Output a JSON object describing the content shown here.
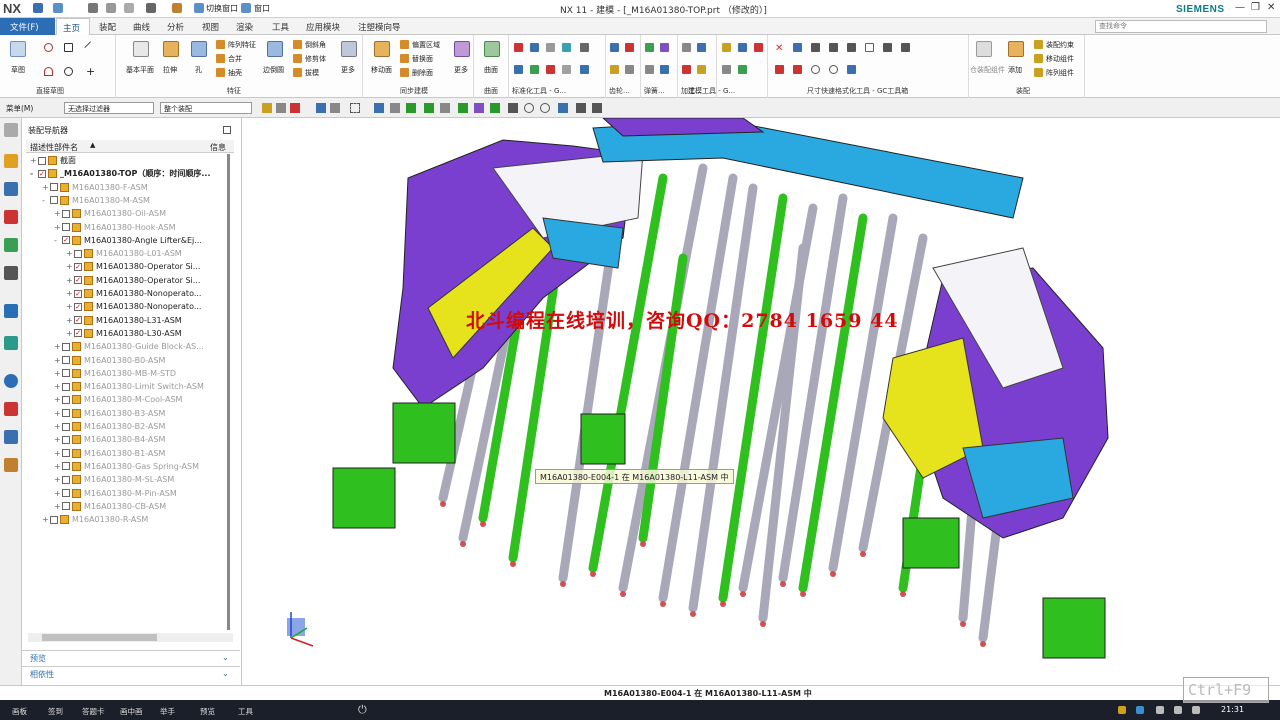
{
  "titlebar": {
    "logo": "NX",
    "title": "NX 11 - 建模 - [_M16A01380-TOP.prt （修改的）]",
    "brand": "SIEMENS",
    "switch_window": "切换窗口",
    "window_menu": "窗口"
  },
  "tabs": {
    "file": "文件(F)",
    "items": [
      "主页",
      "装配",
      "曲线",
      "分析",
      "视图",
      "渲染",
      "工具",
      "应用模块",
      "注塑模向导"
    ],
    "search_placeholder": "查找命令"
  },
  "ribbon": {
    "direct_sketch": {
      "sketch": "草图",
      "group": "直接草图"
    },
    "feature": {
      "datum_plane": "基本平面",
      "extrude": "拉伸",
      "hole": "孔",
      "pattern": "阵列特征",
      "unite": "合并",
      "shell": "抽壳",
      "edge_blend": "边倒圆",
      "chamfer": "倒斜角",
      "trim_body": "修剪体",
      "draft": "拔模",
      "more": "更多",
      "group": "特征"
    },
    "sync": {
      "move_face": "移动面",
      "offset_region": "偏置区域",
      "replace_face": "替换面",
      "delete_face": "删除面",
      "more": "更多",
      "group": "同步建模"
    },
    "surface": {
      "surface": "曲面",
      "group": "曲面"
    },
    "groups_small": [
      "标准化工具 - G...",
      "齿轮...",
      "弹簧...",
      "加工...",
      "建模工具 - G...",
      "尺寸快速格式化工具 - GC工具箱"
    ],
    "assembly": {
      "component": "仓装配组件",
      "add": "添加",
      "constraint": "装配约束",
      "move_component": "移动组件",
      "pattern_component": "阵列组件",
      "group": "装配"
    }
  },
  "toolbar2": {
    "menu": "菜单(M)",
    "filter": "无选择过滤器",
    "scope": "整个装配"
  },
  "navigator": {
    "title": "装配导航器",
    "col_name": "描述性部件名",
    "col_info": "信息",
    "rows": [
      {
        "label": "截面",
        "indent": 0,
        "exp": "+",
        "checked": false,
        "gray": false
      },
      {
        "label": "_M16A01380-TOP（顺序：时间顺序...",
        "indent": 0,
        "exp": "-",
        "checked": true,
        "gray": false,
        "bold": true
      },
      {
        "label": "M16A01380-F-ASM",
        "indent": 1,
        "exp": "+",
        "checked": false,
        "gray": true
      },
      {
        "label": "M16A01380-M-ASM",
        "indent": 1,
        "exp": "-",
        "checked": false,
        "gray": true
      },
      {
        "label": "M16A01380-Oil-ASM",
        "indent": 2,
        "exp": "+",
        "checked": false,
        "gray": true
      },
      {
        "label": "M16A01380-Hook-ASM",
        "indent": 2,
        "exp": "+",
        "checked": false,
        "gray": true
      },
      {
        "label": "M16A01380-Angle Lifter&Ej...",
        "indent": 2,
        "exp": "-",
        "checked": true,
        "gray": false
      },
      {
        "label": "M16A01380-L01-ASM",
        "indent": 3,
        "exp": "+",
        "checked": false,
        "gray": true
      },
      {
        "label": "M16A01380-Operator Si...",
        "indent": 3,
        "exp": "+",
        "checked": true,
        "gray": false
      },
      {
        "label": "M16A01380-Operator Si...",
        "indent": 3,
        "exp": "+",
        "checked": true,
        "gray": false
      },
      {
        "label": "M16A01380-Nonoperato...",
        "indent": 3,
        "exp": "+",
        "checked": true,
        "gray": false
      },
      {
        "label": "M16A01380-Nonoperato...",
        "indent": 3,
        "exp": "+",
        "checked": true,
        "gray": false
      },
      {
        "label": "M16A01380-L31-ASM",
        "indent": 3,
        "exp": "+",
        "checked": true,
        "gray": false
      },
      {
        "label": "M16A01380-L30-ASM",
        "indent": 3,
        "exp": "+",
        "checked": true,
        "gray": false
      },
      {
        "label": "M16A01380-Guide Block-AS...",
        "indent": 2,
        "exp": "+",
        "checked": false,
        "gray": true
      },
      {
        "label": "M16A01380-B0-ASM",
        "indent": 2,
        "exp": "+",
        "checked": false,
        "gray": true
      },
      {
        "label": "M16A01380-MB-M-STD",
        "indent": 2,
        "exp": "+",
        "checked": false,
        "gray": true
      },
      {
        "label": "M16A01380-Limit Switch-ASM",
        "indent": 2,
        "exp": "+",
        "checked": false,
        "gray": true
      },
      {
        "label": "M16A01380-M-Cool-ASM",
        "indent": 2,
        "exp": "+",
        "checked": false,
        "gray": true
      },
      {
        "label": "M16A01380-B3-ASM",
        "indent": 2,
        "exp": "+",
        "checked": false,
        "gray": true
      },
      {
        "label": "M16A01380-B2-ASM",
        "indent": 2,
        "exp": "+",
        "checked": false,
        "gray": true
      },
      {
        "label": "M16A01380-B4-ASM",
        "indent": 2,
        "exp": "+",
        "checked": false,
        "gray": true
      },
      {
        "label": "M16A01380-B1-ASM",
        "indent": 2,
        "exp": "+",
        "checked": false,
        "gray": true
      },
      {
        "label": "M16A01380-Gas Spring-ASM",
        "indent": 2,
        "exp": "+",
        "checked": false,
        "gray": true
      },
      {
        "label": "M16A01380-M-SL-ASM",
        "indent": 2,
        "exp": "+",
        "checked": false,
        "gray": true
      },
      {
        "label": "M16A01380-M-Pin-ASM",
        "indent": 2,
        "exp": "+",
        "checked": false,
        "gray": true
      },
      {
        "label": "M16A01380-CB-ASM",
        "indent": 2,
        "exp": "+",
        "checked": false,
        "gray": true
      },
      {
        "label": "M16A01380-R-ASM",
        "indent": 1,
        "exp": "+",
        "checked": false,
        "gray": true
      }
    ],
    "preview": "预览",
    "dependency": "相依性"
  },
  "viewport": {
    "watermark": "北斗编程在线培训，咨询QQ：2784 1659 44",
    "tooltip": "M16A01380-E004-1 在 M16A01380-L11-ASM 中"
  },
  "status": {
    "text": "M16A01380-E004-1 在 M16A01380-L11-ASM 中"
  },
  "taskbar": {
    "items": [
      "画板",
      "签到",
      "答题卡",
      "画中画",
      "举手",
      "预览",
      "工具"
    ],
    "clock": "21:31"
  },
  "overlay": {
    "ctrl_hint": "Ctrl+F9"
  },
  "colors": {
    "accent": "#2c6eb5",
    "part_purple": "#7b3fd0",
    "part_green": "#2fbf1e",
    "part_yellow": "#e6e21c",
    "part_cyan": "#29a9e0",
    "pin_gray": "#a8a8b8",
    "watermark_red": "#d30a0a"
  }
}
